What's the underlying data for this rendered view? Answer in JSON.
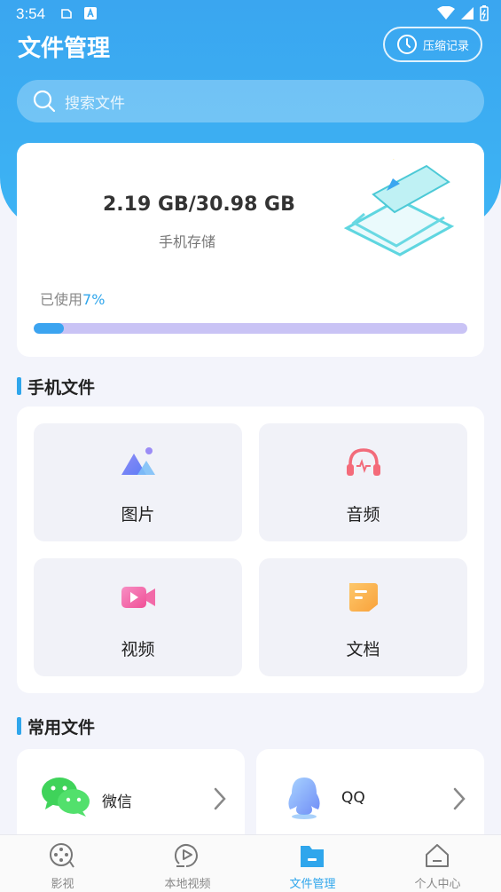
{
  "status_bar": {
    "time": "3:54"
  },
  "header": {
    "title": "文件管理",
    "history_button": "压缩记录",
    "search_placeholder": "搜索文件"
  },
  "storage": {
    "amount": "2.19 GB/30.98 GB",
    "label": "手机存储",
    "used_prefix": "已使用",
    "used_percent_text": "7%",
    "used_fraction": 0.07
  },
  "phone_files": {
    "title": "手机文件",
    "items": [
      {
        "label": "图片",
        "icon": "image-icon"
      },
      {
        "label": "音频",
        "icon": "headphones-icon"
      },
      {
        "label": "视频",
        "icon": "video-icon"
      },
      {
        "label": "文档",
        "icon": "document-icon"
      }
    ]
  },
  "common_files": {
    "title": "常用文件",
    "items": [
      {
        "label": "微信",
        "icon": "wechat-icon"
      },
      {
        "label": "QQ",
        "icon": "qq-icon"
      }
    ]
  },
  "tabbar": {
    "active": 2,
    "items": [
      {
        "label": "影视",
        "icon": "film-reel-icon"
      },
      {
        "label": "本地视频",
        "icon": "play-icon"
      },
      {
        "label": "文件管理",
        "icon": "folder-icon"
      },
      {
        "label": "个人中心",
        "icon": "home-icon"
      }
    ]
  },
  "colors": {
    "accent": "#2fa6ec",
    "header": "#3aa6f0",
    "progress_track": "#c9c3f5"
  }
}
